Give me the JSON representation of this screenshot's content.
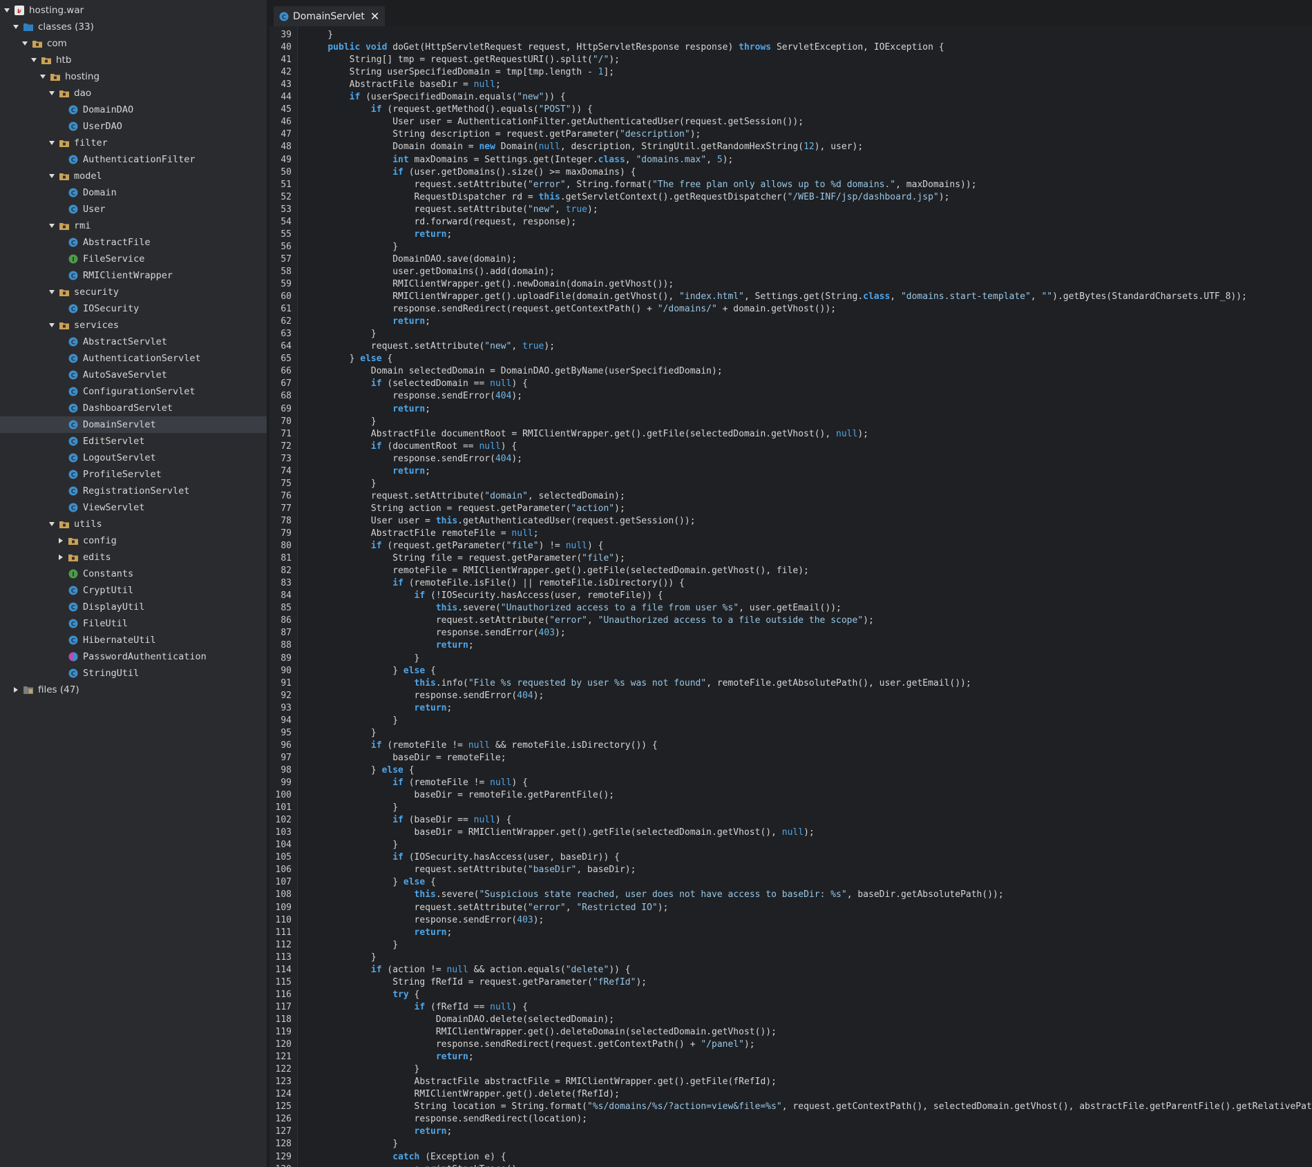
{
  "sidebar": {
    "tree": [
      {
        "label": "hosting.war",
        "depth": 0,
        "caret": "open",
        "icon": "war-archive-icon",
        "name": "tree-node-hosting-war",
        "sans": true
      },
      {
        "label": "classes (33)",
        "depth": 1,
        "caret": "open",
        "icon": "classes-folder-icon",
        "name": "tree-node-classes",
        "sans": true
      },
      {
        "label": "com",
        "depth": 2,
        "caret": "open",
        "icon": "package-icon",
        "name": "tree-node-com",
        "sans": true
      },
      {
        "label": "htb",
        "depth": 3,
        "caret": "open",
        "icon": "package-icon",
        "name": "tree-node-htb",
        "sans": true
      },
      {
        "label": "hosting",
        "depth": 4,
        "caret": "open",
        "icon": "package-icon",
        "name": "tree-node-hosting",
        "sans": true
      },
      {
        "label": "dao",
        "depth": 5,
        "caret": "open",
        "icon": "package-icon",
        "name": "tree-node-dao",
        "sans": true
      },
      {
        "label": "DomainDAO",
        "depth": 6,
        "caret": "none",
        "icon": "class-icon",
        "name": "tree-node-domaindao"
      },
      {
        "label": "UserDAO",
        "depth": 6,
        "caret": "none",
        "icon": "class-icon",
        "name": "tree-node-userdao"
      },
      {
        "label": "filter",
        "depth": 5,
        "caret": "open",
        "icon": "package-icon",
        "name": "tree-node-filter"
      },
      {
        "label": "AuthenticationFilter",
        "depth": 6,
        "caret": "none",
        "icon": "class-icon",
        "name": "tree-node-authenticationfilter"
      },
      {
        "label": "model",
        "depth": 5,
        "caret": "open",
        "icon": "package-icon",
        "name": "tree-node-model"
      },
      {
        "label": "Domain",
        "depth": 6,
        "caret": "none",
        "icon": "class-icon",
        "name": "tree-node-domain"
      },
      {
        "label": "User",
        "depth": 6,
        "caret": "none",
        "icon": "class-icon",
        "name": "tree-node-user"
      },
      {
        "label": "rmi",
        "depth": 5,
        "caret": "open",
        "icon": "package-icon",
        "name": "tree-node-rmi"
      },
      {
        "label": "AbstractFile",
        "depth": 6,
        "caret": "none",
        "icon": "class-icon",
        "name": "tree-node-abstractfile"
      },
      {
        "label": "FileService",
        "depth": 6,
        "caret": "none",
        "icon": "interface-icon",
        "name": "tree-node-fileservice"
      },
      {
        "label": "RMIClientWrapper",
        "depth": 6,
        "caret": "none",
        "icon": "class-icon",
        "name": "tree-node-rmiclientwrapper"
      },
      {
        "label": "security",
        "depth": 5,
        "caret": "open",
        "icon": "package-icon",
        "name": "tree-node-security"
      },
      {
        "label": "IOSecurity",
        "depth": 6,
        "caret": "none",
        "icon": "class-icon",
        "name": "tree-node-iosecurity"
      },
      {
        "label": "services",
        "depth": 5,
        "caret": "open",
        "icon": "package-icon",
        "name": "tree-node-services"
      },
      {
        "label": "AbstractServlet",
        "depth": 6,
        "caret": "none",
        "icon": "class-icon",
        "name": "tree-node-abstractservlet"
      },
      {
        "label": "AuthenticationServlet",
        "depth": 6,
        "caret": "none",
        "icon": "class-icon",
        "name": "tree-node-authenticationservlet"
      },
      {
        "label": "AutoSaveServlet",
        "depth": 6,
        "caret": "none",
        "icon": "class-icon",
        "name": "tree-node-autosaveservlet"
      },
      {
        "label": "ConfigurationServlet",
        "depth": 6,
        "caret": "none",
        "icon": "class-icon",
        "name": "tree-node-configurationservlet"
      },
      {
        "label": "DashboardServlet",
        "depth": 6,
        "caret": "none",
        "icon": "class-icon",
        "name": "tree-node-dashboardservlet"
      },
      {
        "label": "DomainServlet",
        "depth": 6,
        "caret": "none",
        "icon": "class-icon",
        "name": "tree-node-domainservlet",
        "selected": true
      },
      {
        "label": "EditServlet",
        "depth": 6,
        "caret": "none",
        "icon": "class-icon",
        "name": "tree-node-editservlet"
      },
      {
        "label": "LogoutServlet",
        "depth": 6,
        "caret": "none",
        "icon": "class-icon",
        "name": "tree-node-logoutservlet"
      },
      {
        "label": "ProfileServlet",
        "depth": 6,
        "caret": "none",
        "icon": "class-icon",
        "name": "tree-node-profileservlet"
      },
      {
        "label": "RegistrationServlet",
        "depth": 6,
        "caret": "none",
        "icon": "class-icon",
        "name": "tree-node-registrationservlet"
      },
      {
        "label": "ViewServlet",
        "depth": 6,
        "caret": "none",
        "icon": "class-icon",
        "name": "tree-node-viewservlet"
      },
      {
        "label": "utils",
        "depth": 5,
        "caret": "open",
        "icon": "package-icon",
        "name": "tree-node-utils"
      },
      {
        "label": "config",
        "depth": 6,
        "caret": "closed",
        "icon": "package-icon",
        "name": "tree-node-config",
        "folderChild": true
      },
      {
        "label": "edits",
        "depth": 6,
        "caret": "closed",
        "icon": "package-icon",
        "name": "tree-node-edits",
        "folderChild": true
      },
      {
        "label": "Constants",
        "depth": 6,
        "caret": "none",
        "icon": "interface-icon",
        "name": "tree-node-constants"
      },
      {
        "label": "CryptUtil",
        "depth": 6,
        "caret": "none",
        "icon": "class-icon",
        "name": "tree-node-cryptutil"
      },
      {
        "label": "DisplayUtil",
        "depth": 6,
        "caret": "none",
        "icon": "class-icon",
        "name": "tree-node-displayutil"
      },
      {
        "label": "FileUtil",
        "depth": 6,
        "caret": "none",
        "icon": "class-icon",
        "name": "tree-node-fileutil"
      },
      {
        "label": "HibernateUtil",
        "depth": 6,
        "caret": "none",
        "icon": "class-icon",
        "name": "tree-node-hibernateutil"
      },
      {
        "label": "PasswordAuthentication",
        "depth": 6,
        "caret": "none",
        "icon": "enum-class-icon",
        "name": "tree-node-passwordauthentication"
      },
      {
        "label": "StringUtil",
        "depth": 6,
        "caret": "none",
        "icon": "class-icon",
        "name": "tree-node-stringutil"
      },
      {
        "label": "files (47)",
        "depth": 1,
        "caret": "closed",
        "icon": "resource-files-icon",
        "name": "tree-node-files",
        "sans": true
      }
    ]
  },
  "tab": {
    "label": "DomainServlet",
    "icon": "class-icon",
    "close": "✕"
  },
  "colors": {
    "keyword": "#4ea6ea",
    "string": "#98c7e6",
    "number": "#6fb7e8",
    "class_icon": "#3d8fc9",
    "interface_icon": "#4f9a4a",
    "enum_icon": "#b54db8",
    "folder_icon": "#c9a25a"
  },
  "editor": {
    "first_line": 39,
    "last_visible_line": 130,
    "lines": [
      "    }",
      "    public void doGet(HttpServletRequest request, HttpServletResponse response) throws ServletException, IOException {",
      "        String[] tmp = request.getRequestURI().split(\"/\");",
      "        String userSpecifiedDomain = tmp[tmp.length - 1];",
      "        AbstractFile baseDir = null;",
      "        if (userSpecifiedDomain.equals(\"new\")) {",
      "            if (request.getMethod().equals(\"POST\")) {",
      "                User user = AuthenticationFilter.getAuthenticatedUser(request.getSession());",
      "                String description = request.getParameter(\"description\");",
      "                Domain domain = new Domain(null, description, StringUtil.getRandomHexString(12), user);",
      "                int maxDomains = Settings.get(Integer.class, \"domains.max\", 5);",
      "                if (user.getDomains().size() >= maxDomains) {",
      "                    request.setAttribute(\"error\", String.format(\"The free plan only allows up to %d domains.\", maxDomains));",
      "                    RequestDispatcher rd = this.getServletContext().getRequestDispatcher(\"/WEB-INF/jsp/dashboard.jsp\");",
      "                    request.setAttribute(\"new\", true);",
      "                    rd.forward(request, response);",
      "                    return;",
      "                }",
      "                DomainDAO.save(domain);",
      "                user.getDomains().add(domain);",
      "                RMIClientWrapper.get().newDomain(domain.getVhost());",
      "                RMIClientWrapper.get().uploadFile(domain.getVhost(), \"index.html\", Settings.get(String.class, \"domains.start-template\", \"\").getBytes(StandardCharsets.UTF_8));",
      "                response.sendRedirect(request.getContextPath() + \"/domains/\" + domain.getVhost());",
      "                return;",
      "            }",
      "            request.setAttribute(\"new\", true);",
      "        } else {",
      "            Domain selectedDomain = DomainDAO.getByName(userSpecifiedDomain);",
      "            if (selectedDomain == null) {",
      "                response.sendError(404);",
      "                return;",
      "            }",
      "            AbstractFile documentRoot = RMIClientWrapper.get().getFile(selectedDomain.getVhost(), null);",
      "            if (documentRoot == null) {",
      "                response.sendError(404);",
      "                return;",
      "            }",
      "            request.setAttribute(\"domain\", selectedDomain);",
      "            String action = request.getParameter(\"action\");",
      "            User user = this.getAuthenticatedUser(request.getSession());",
      "            AbstractFile remoteFile = null;",
      "            if (request.getParameter(\"file\") != null) {",
      "                String file = request.getParameter(\"file\");",
      "                remoteFile = RMIClientWrapper.get().getFile(selectedDomain.getVhost(), file);",
      "                if (remoteFile.isFile() || remoteFile.isDirectory()) {",
      "                    if (!IOSecurity.hasAccess(user, remoteFile)) {",
      "                        this.severe(\"Unauthorized access to a file from user %s\", user.getEmail());",
      "                        request.setAttribute(\"error\", \"Unauthorized access to a file outside the scope\");",
      "                        response.sendError(403);",
      "                        return;",
      "                    }",
      "                } else {",
      "                    this.info(\"File %s requested by user %s was not found\", remoteFile.getAbsolutePath(), user.getEmail());",
      "                    response.sendError(404);",
      "                    return;",
      "                }",
      "            }",
      "            if (remoteFile != null && remoteFile.isDirectory()) {",
      "                baseDir = remoteFile;",
      "            } else {",
      "                if (remoteFile != null) {",
      "                    baseDir = remoteFile.getParentFile();",
      "                }",
      "                if (baseDir == null) {",
      "                    baseDir = RMIClientWrapper.get().getFile(selectedDomain.getVhost(), null);",
      "                }",
      "                if (IOSecurity.hasAccess(user, baseDir)) {",
      "                    request.setAttribute(\"baseDir\", baseDir);",
      "                } else {",
      "                    this.severe(\"Suspicious state reached, user does not have access to baseDir: %s\", baseDir.getAbsolutePath());",
      "                    request.setAttribute(\"error\", \"Restricted IO\");",
      "                    response.sendError(403);",
      "                    return;",
      "                }",
      "            }",
      "            if (action != null && action.equals(\"delete\")) {",
      "                String fRefId = request.getParameter(\"fRefId\");",
      "                try {",
      "                    if (fRefId == null) {",
      "                        DomainDAO.delete(selectedDomain);",
      "                        RMIClientWrapper.get().deleteDomain(selectedDomain.getVhost());",
      "                        response.sendRedirect(request.getContextPath() + \"/panel\");",
      "                        return;",
      "                    }",
      "                    AbstractFile abstractFile = RMIClientWrapper.get().getFile(fRefId);",
      "                    RMIClientWrapper.get().delete(fRefId);",
      "                    String location = String.format(\"%s/domains/%s/?action=view&file=%s\", request.getContextPath(), selectedDomain.getVhost(), abstractFile.getParentFile().getRelativePath());",
      "                    response.sendRedirect(location);",
      "                    return;",
      "                }",
      "                catch (Exception e) {",
      "                    e.printStackTrace();"
    ]
  }
}
